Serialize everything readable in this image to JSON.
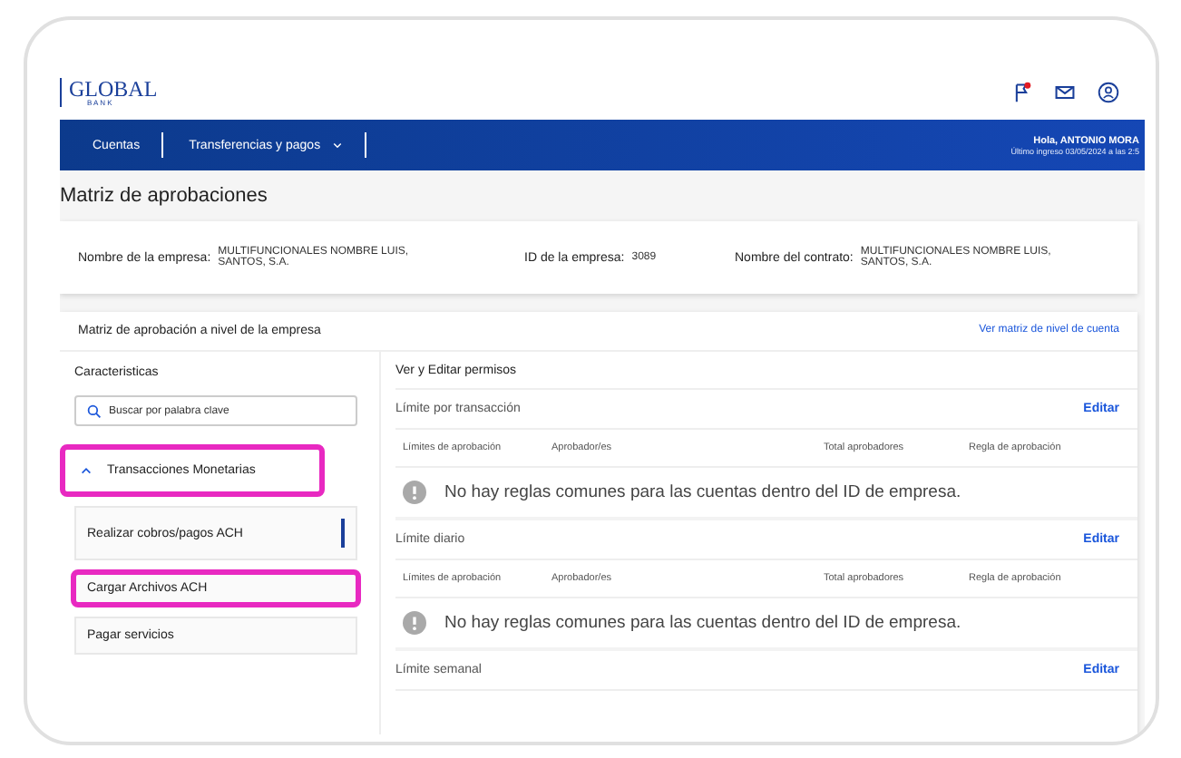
{
  "header": {
    "logo_main": "GLOBAL",
    "logo_sub": "B A N K",
    "notification_dot": true
  },
  "nav": {
    "items": [
      {
        "label": "Cuentas",
        "dropdown": false
      },
      {
        "label": "Transferencias y pagos",
        "dropdown": true
      }
    ],
    "greeting": "Hola, ANTONIO MORA",
    "last_login": "Último ingreso 03/05/2024 a las 2:5"
  },
  "page_title": "Matriz de aprobaciones",
  "info": [
    {
      "label": "Nombre de la empresa:",
      "value": "MULTIFUNCIONALES NOMBRE LUIS, SANTOS, S.A."
    },
    {
      "label": "ID de la empresa:",
      "value": "3089"
    },
    {
      "label": "Nombre del contrato:",
      "value": "MULTIFUNCIONALES NOMBRE LUIS, SANTOS, S.A."
    }
  ],
  "matrix": {
    "title": "Matriz de aprobación a nivel de la empresa",
    "link": "Ver matriz de nivel de cuenta"
  },
  "sidebar": {
    "title": "Caracteristicas",
    "search": {
      "placeholder": "Buscar por palabra clave"
    },
    "group": {
      "label": "Transacciones Monetarias",
      "expanded": true,
      "highlighted": true
    },
    "items": [
      {
        "label": "Realizar cobros/pagos ACH",
        "selected": true,
        "highlighted": false
      },
      {
        "label": "Cargar Archivos ACH",
        "selected": false,
        "highlighted": true
      },
      {
        "label": "Pagar servicios",
        "selected": false,
        "highlighted": false
      }
    ]
  },
  "permissions": {
    "title": "Ver y Editar permisos",
    "sections": [
      {
        "title": "Límite por transacción",
        "action": "Editar",
        "columns": [
          "Límites de aprobación",
          "Aprobador/es",
          "Total aprobadores",
          "Regla de aprobación"
        ],
        "message": "No hay reglas comunes para las cuentas dentro del ID de empresa."
      },
      {
        "title": "Límite diario",
        "action": "Editar",
        "columns": [
          "Límites de aprobación",
          "Aprobador/es",
          "Total aprobadores",
          "Regla de aprobación"
        ],
        "message": "No hay reglas comunes para las cuentas dentro del ID de empresa."
      },
      {
        "title": "Límite semanal",
        "action": "Editar"
      }
    ]
  }
}
